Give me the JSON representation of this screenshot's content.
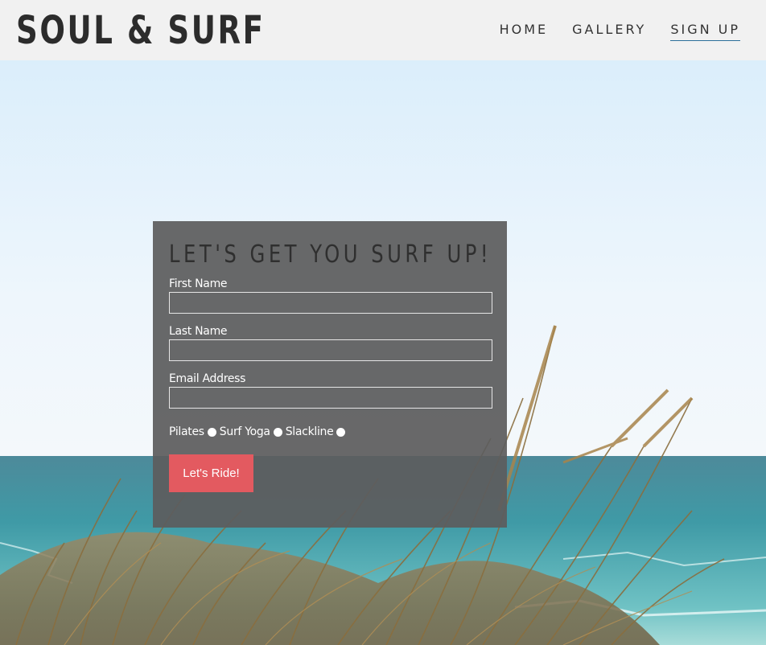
{
  "header": {
    "logo": "SOUL & SURF",
    "nav": [
      {
        "label": "HOME",
        "active": false
      },
      {
        "label": "GALLERY",
        "active": false
      },
      {
        "label": "SIGN UP",
        "active": true
      }
    ]
  },
  "form": {
    "title": "LET'S GET YOU SURF UP!",
    "fields": [
      {
        "label": "First Name",
        "value": ""
      },
      {
        "label": "Last Name",
        "value": ""
      },
      {
        "label": "Email Address",
        "value": ""
      }
    ],
    "options": [
      "Pilates",
      "Surf Yoga",
      "Slackline"
    ],
    "submit_label": "Let's Ride!"
  },
  "colors": {
    "header_bg": "#f1f1f1",
    "panel_bg": "#5c5d5e",
    "button": "#e35a60",
    "active_underline": "#2c6f9a"
  },
  "background_image": "beach-dune-grass-photo"
}
